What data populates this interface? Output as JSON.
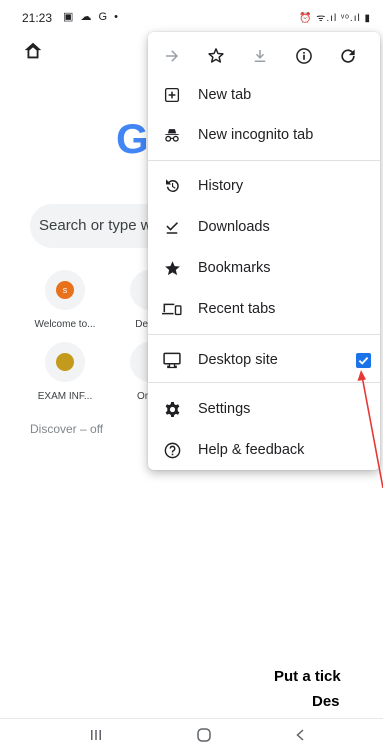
{
  "status_bar": {
    "time": "21:23",
    "left_icons": "▣ ☁ G •",
    "right_icons": "⏰ ᯤ.ıl ᵛᵒ.ıl ▮"
  },
  "page": {
    "search_placeholder": "Search or type web address",
    "logo_letter": "G",
    "tiles": [
      {
        "label": "Welcome to...",
        "avatar_letter": "s",
        "avatar_color": "#e8711c"
      },
      {
        "label": "Dem...",
        "avatar_letter": "",
        "avatar_color": "#dadce0"
      },
      {
        "label": "EXAM INF...",
        "avatar_letter": "",
        "avatar_color": "#c49a1c"
      },
      {
        "label": "Onli...",
        "avatar_letter": "",
        "avatar_color": "#dadce0"
      }
    ],
    "discover": "Discover – off"
  },
  "menu": {
    "toolbar": [
      "forward",
      "bookmark",
      "download",
      "page-info",
      "refresh"
    ],
    "items": [
      {
        "label": "New tab",
        "icon": "new-tab-icon"
      },
      {
        "label": "New incognito tab",
        "icon": "incognito-icon"
      },
      {
        "label": "History",
        "icon": "history-icon"
      },
      {
        "label": "Downloads",
        "icon": "downloads-icon"
      },
      {
        "label": "Bookmarks",
        "icon": "bookmarks-icon"
      },
      {
        "label": "Recent tabs",
        "icon": "recent-tabs-icon"
      },
      {
        "label": "Desktop site",
        "icon": "desktop-icon",
        "checked": true
      },
      {
        "label": "Settings",
        "icon": "settings-icon"
      },
      {
        "label": "Help & feedback",
        "icon": "help-icon"
      }
    ]
  },
  "annotation": {
    "line1": "Put a tick",
    "line2": "Des",
    "arrow_color": "#e53935"
  },
  "nav": [
    "recent-apps",
    "home",
    "back"
  ],
  "colors": {
    "accent": "#1a73e8",
    "icon_gray": "#5f6368"
  }
}
